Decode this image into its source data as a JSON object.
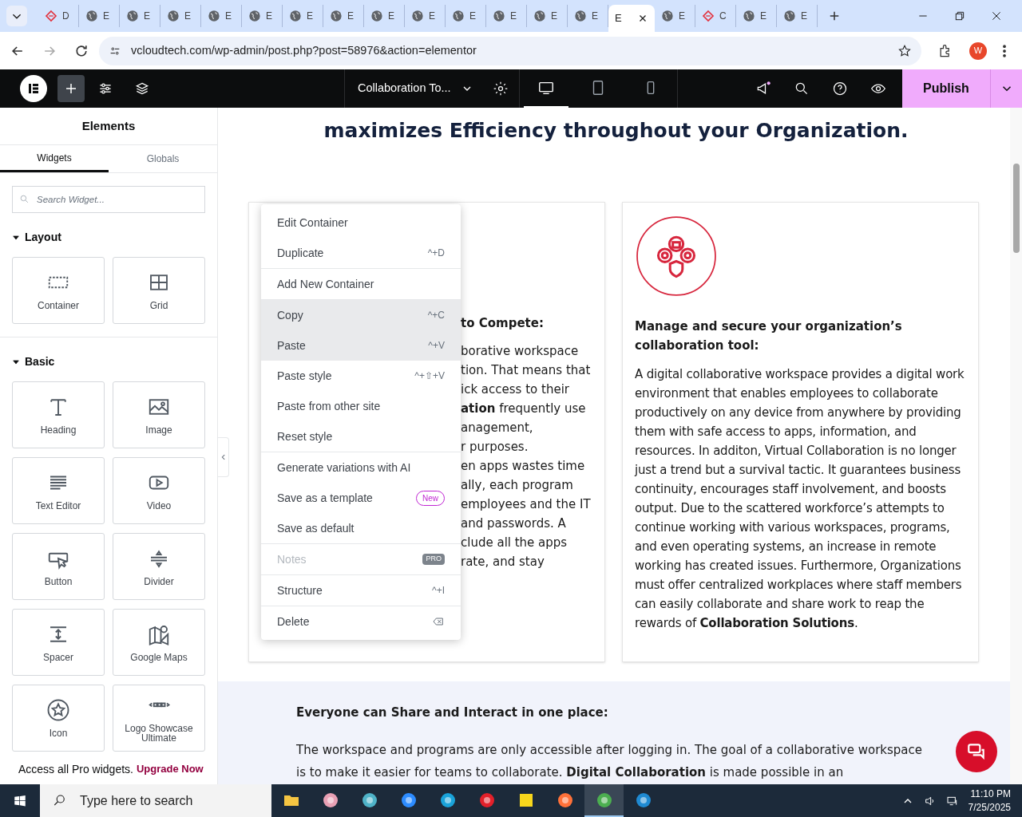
{
  "browser": {
    "tabs": [
      {
        "label": "D",
        "kind": "logo",
        "selected": false
      },
      {
        "label": "E",
        "kind": "globe",
        "selected": false
      },
      {
        "label": "E",
        "kind": "globe",
        "selected": false
      },
      {
        "label": "E",
        "kind": "globe",
        "selected": false
      },
      {
        "label": "E",
        "kind": "globe",
        "selected": false
      },
      {
        "label": "E",
        "kind": "globe",
        "selected": false
      },
      {
        "label": "E",
        "kind": "globe",
        "selected": false
      },
      {
        "label": "E",
        "kind": "globe",
        "selected": false
      },
      {
        "label": "E",
        "kind": "globe",
        "selected": false
      },
      {
        "label": "E",
        "kind": "globe",
        "selected": false
      },
      {
        "label": "E",
        "kind": "globe",
        "selected": false
      },
      {
        "label": "E",
        "kind": "globe",
        "selected": false
      },
      {
        "label": "E",
        "kind": "globe",
        "selected": false
      },
      {
        "label": "E",
        "kind": "globe",
        "selected": false
      },
      {
        "label": "E",
        "kind": "none",
        "selected": true
      },
      {
        "label": "E",
        "kind": "globe",
        "selected": false
      },
      {
        "label": "C",
        "kind": "logo",
        "selected": false
      },
      {
        "label": "E",
        "kind": "globe",
        "selected": false
      },
      {
        "label": "E",
        "kind": "globe",
        "selected": false
      }
    ],
    "url": "vcloudtech.com/wp-admin/post.php?post=58976&action=elementor",
    "profile": "W"
  },
  "editor_bar": {
    "document_title": "Collaboration To...",
    "publish": "Publish",
    "devices": [
      {
        "kind": "desktop",
        "selected": true
      },
      {
        "kind": "tablet",
        "selected": false
      },
      {
        "kind": "mobile",
        "selected": false
      }
    ]
  },
  "panel": {
    "title": "Elements",
    "tabs": [
      {
        "label": "Widgets",
        "selected": true
      },
      {
        "label": "Globals",
        "selected": false
      }
    ],
    "search": {
      "placeholder": "Search Widget..."
    },
    "categories": [
      {
        "title": "Layout",
        "expanded": true,
        "widgets": [
          {
            "label": "Container",
            "kind": "container"
          },
          {
            "label": "Grid",
            "kind": "grid"
          }
        ]
      },
      {
        "title": "Basic",
        "expanded": true,
        "widgets": [
          {
            "label": "Heading",
            "kind": "heading"
          },
          {
            "label": "Image",
            "kind": "image"
          },
          {
            "label": "Text Editor",
            "kind": "text"
          },
          {
            "label": "Video",
            "kind": "video"
          },
          {
            "label": "Button",
            "kind": "button"
          },
          {
            "label": "Divider",
            "kind": "divider"
          },
          {
            "label": "Spacer",
            "kind": "spacer"
          },
          {
            "label": "Google Maps",
            "kind": "map"
          },
          {
            "label": "Icon",
            "kind": "star"
          },
          {
            "label": "Logo Showcase Ultimate",
            "kind": "dots"
          }
        ]
      }
    ],
    "promo": {
      "text": "Access all Pro widgets.",
      "link": "Upgrade Now"
    }
  },
  "page": {
    "heading": "maximizes Efficiency throughout your Organization.",
    "left_card": {
      "heading": "to Compete:",
      "lines": [
        "borative workspace",
        "tion. That means that",
        "ick access to their",
        "**ation** frequently use",
        "anagement,",
        "r purposes.",
        "en apps wastes time",
        "ally, each program",
        "employees and the IT",
        "and passwords. A",
        "clude all the apps",
        "rate, and stay"
      ]
    },
    "right_card": {
      "heading": "Manage and secure your organization’s collaboration tool:",
      "paragraph": "A digital collaborative workspace provides a digital work environment that enables employees to collaborate productively on any device from anywhere by providing them with safe access to apps, information, and resources. In additon, Virtual Collaboration is no longer just a trend but a survival tactic. It guarantees business continuity, encourages staff involvement, and boosts output. Due to the scattered workforce’s attempts to continue working with various workspaces, programs, and even operating systems, an increase in remote working has created issues. Furthermore, Organizations must offer centralized workplaces where staff members can easily collaborate and share work to reap the rewards of **Collaboration Solutions**."
    },
    "section": {
      "heading": "Everyone can Share and Interact in one place:",
      "paragraph": "The workspace and programs are only accessible after logging in. The goal of a collaborative workspace is to make it easier for teams to collaborate. **Digital Collaboration** is made possible in an"
    }
  },
  "context_menu": {
    "groups": [
      [
        {
          "label": "Edit Container",
          "kind": "plain",
          "disabled": false,
          "highlighted": false
        },
        {
          "label": "Duplicate",
          "shortcut": "^+D",
          "kind": "shortcut",
          "disabled": false,
          "highlighted": false
        }
      ],
      [
        {
          "label": "Add New Container",
          "kind": "plain",
          "disabled": false,
          "highlighted": false
        }
      ],
      [
        {
          "label": "Copy",
          "shortcut": "^+C",
          "kind": "shortcut",
          "disabled": false,
          "highlighted": true
        },
        {
          "label": "Paste",
          "shortcut": "^+V",
          "kind": "shortcut",
          "disabled": false,
          "highlighted": true
        },
        {
          "label": "Paste style",
          "shortcut": "^+⇧+V",
          "kind": "shortcut",
          "disabled": false,
          "highlighted": false
        },
        {
          "label": "Paste from other site",
          "kind": "plain",
          "disabled": false,
          "highlighted": false
        },
        {
          "label": "Reset style",
          "kind": "plain",
          "disabled": false,
          "highlighted": false
        }
      ],
      [
        {
          "label": "Generate variations with AI",
          "kind": "plain",
          "disabled": false,
          "highlighted": false
        },
        {
          "label": "Save as a template",
          "badge": "New",
          "kind": "badge",
          "disabled": false,
          "highlighted": false
        },
        {
          "label": "Save as default",
          "kind": "plain",
          "disabled": false,
          "highlighted": false
        }
      ],
      [
        {
          "label": "Notes",
          "badge": "PRO",
          "kind": "badge",
          "disabled": true,
          "highlighted": false
        }
      ],
      [
        {
          "label": "Structure",
          "shortcut": "^+I",
          "kind": "shortcut",
          "disabled": false,
          "highlighted": false
        }
      ],
      [
        {
          "label": "Delete",
          "kind": "key-icon",
          "disabled": false,
          "highlighted": false
        }
      ]
    ]
  },
  "taskbar": {
    "search": {
      "placeholder": "Type here to search"
    },
    "apps": [
      {
        "kind": "folder",
        "selected": false
      },
      {
        "kind": "paint",
        "selected": false
      },
      {
        "kind": "cube",
        "selected": false
      },
      {
        "kind": "zoom",
        "selected": false
      },
      {
        "kind": "edge",
        "selected": false
      },
      {
        "kind": "opera",
        "selected": false
      },
      {
        "kind": "notes",
        "selected": false
      },
      {
        "kind": "firefox",
        "selected": false
      },
      {
        "kind": "chrome",
        "selected": true
      },
      {
        "kind": "vscode",
        "selected": false
      }
    ],
    "time": "11:10 PM",
    "date": "7/25/2025"
  }
}
